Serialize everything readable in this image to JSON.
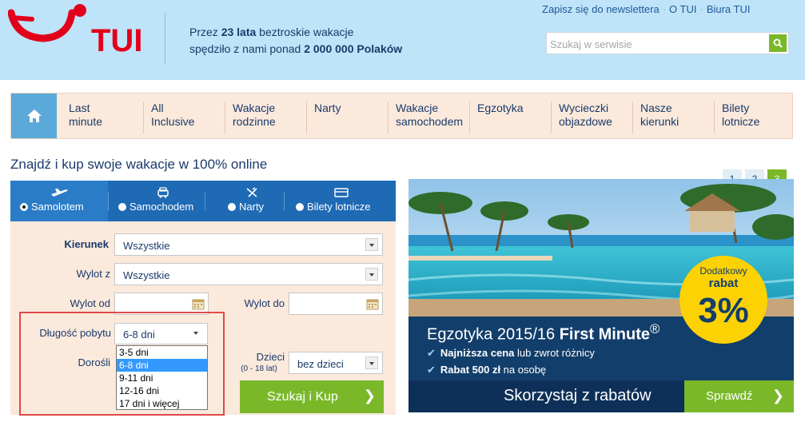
{
  "header": {
    "brand": "TUI",
    "tagline_line1_pre": "Przez ",
    "tagline_line1_bold": "23 lata",
    "tagline_line1_post": " beztroskie wakacje",
    "tagline_line2_pre": "spędziło z nami ponad ",
    "tagline_line2_bold": "2 000 000 Polaków",
    "links": [
      "Zapisz się do newslettera",
      "O TUI",
      "Biura TUI"
    ],
    "search_placeholder": "Szukaj w serwisie"
  },
  "nav": {
    "items": [
      {
        "label_line1": "Last",
        "label_line2": "minute"
      },
      {
        "label_line1": "All",
        "label_line2": "Inclusive"
      },
      {
        "label_line1": "Wakacje",
        "label_line2": "rodzinne"
      },
      {
        "label_line1": "Narty",
        "label_line2": ""
      },
      {
        "label_line1": "Wakacje",
        "label_line2": "samochodem"
      },
      {
        "label_line1": "Egzotyka",
        "label_line2": ""
      },
      {
        "label_line1": "Wycieczki",
        "label_line2": "objazdowe"
      },
      {
        "label_line1": "Nasze",
        "label_line2": "kierunki"
      },
      {
        "label_line1": "Bilety",
        "label_line2": "lotnicze"
      }
    ]
  },
  "main": {
    "heading": "Znajdź i kup swoje wakacje w 100% online"
  },
  "form": {
    "tabs": [
      {
        "label": "Samolotem",
        "icon": "plane-icon",
        "active": true
      },
      {
        "label": "Samochodem",
        "icon": "car-icon",
        "active": false
      },
      {
        "label": "Narty",
        "icon": "ski-icon",
        "active": false
      },
      {
        "label": "Bilety lotnicze",
        "icon": "ticket-icon",
        "active": false
      }
    ],
    "kierunek_label": "Kierunek",
    "kierunek_value": "Wszystkie",
    "wylot_z_label": "Wylot z",
    "wylot_z_value": "Wszystkie",
    "wylot_od_label": "Wylot od",
    "wylot_do_label": "Wylot do",
    "dlugosc_label": "Długość pobytu",
    "dlugosc_value": "6-8 dni",
    "dlugosc_options": [
      "3-5 dni",
      "6-8 dni",
      "9-11 dni",
      "12-16 dni",
      "17 dni i więcej"
    ],
    "dorosli_label": "Dorośli",
    "dzieci_label": "Dzieci",
    "dzieci_sublabel": "(0 - 18 lat)",
    "dzieci_value": "bez dzieci",
    "search_button": "Szukaj i Kup",
    "chevron": "❯"
  },
  "banner": {
    "pages": [
      "1",
      "2",
      "3"
    ],
    "active_page": "3",
    "title_pre": "Egzotyka 2015/16 ",
    "title_bold": "First Minute",
    "title_sup": "®",
    "line1_bold": "Najniższa cena",
    "line1_rest": " lub zwrot różnicy",
    "line2_bold": "Rabat 500 zł",
    "line2_rest": " na osobę",
    "badge_line1": "Dodatkowy",
    "badge_line2": "rabat",
    "badge_line3": "3%",
    "cta_text": "Skorzystaj z rabatów",
    "cta_button": "Sprawdź",
    "check": "✔"
  },
  "colors": {
    "header_bg": "#bfe3f8",
    "brand_red": "#e2001a",
    "nav_bg": "#fbe9dc",
    "tab_blue": "#1e6ab5",
    "green": "#7ab829",
    "banner_dark": "#123e6b",
    "badge_yellow": "#fcd205",
    "highlight_red": "#e0484a"
  }
}
